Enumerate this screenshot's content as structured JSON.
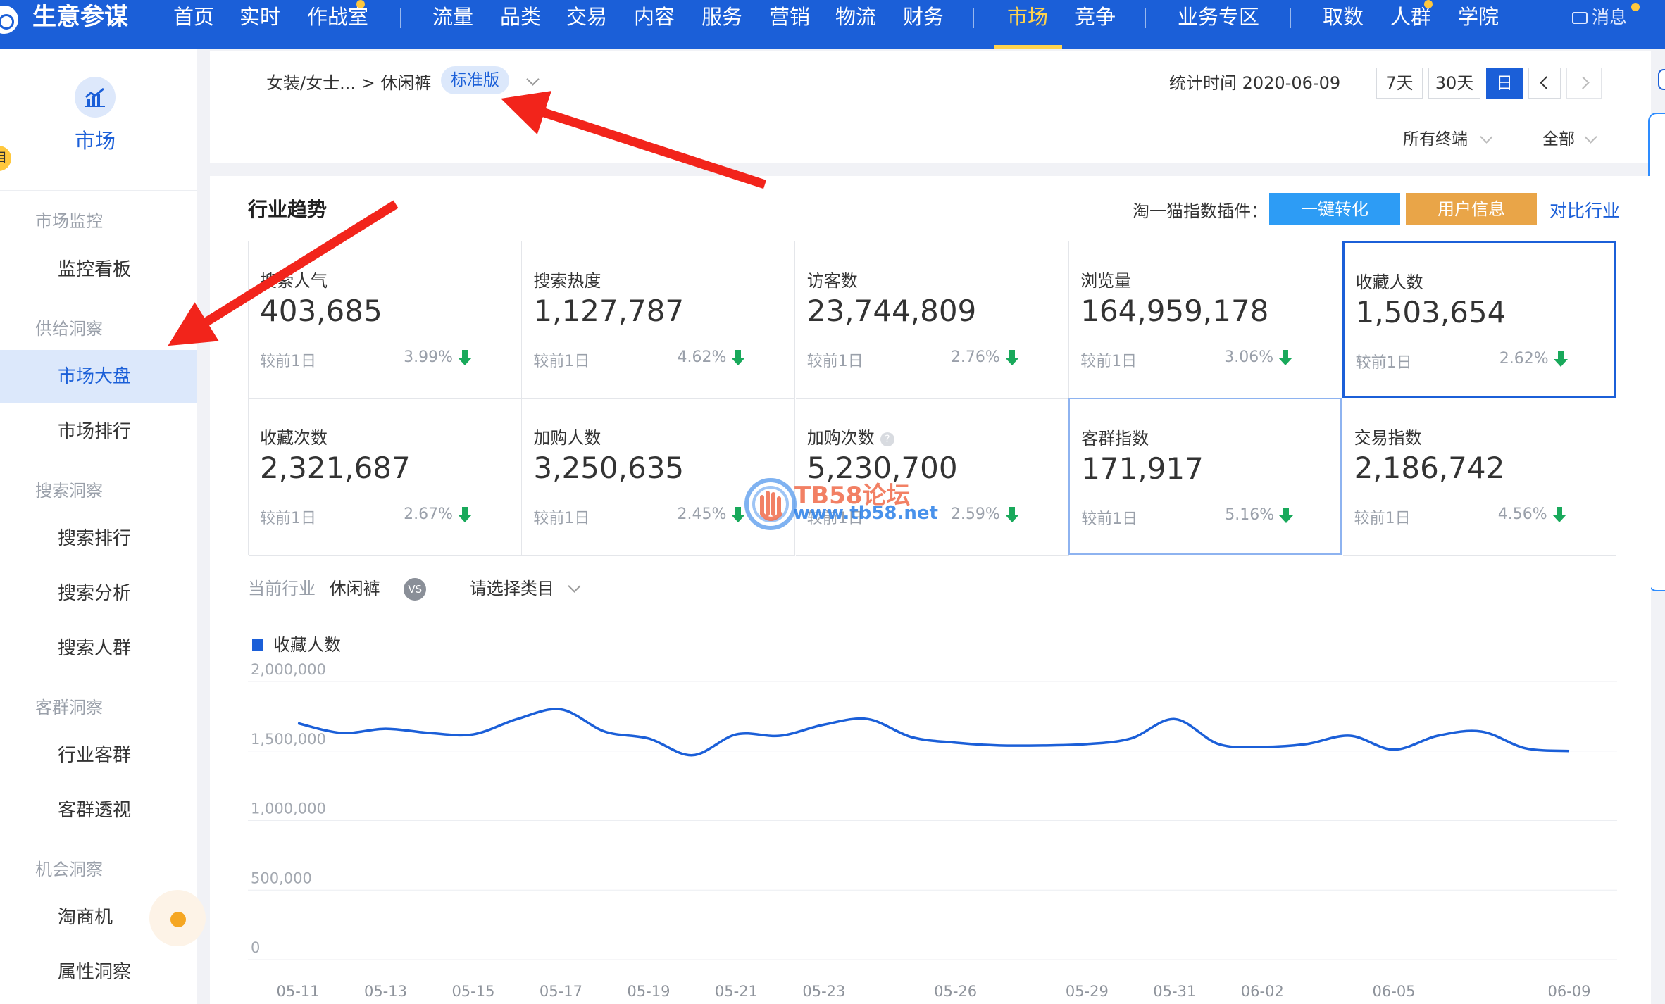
{
  "topnav": {
    "brand": "生意参谋",
    "items": [
      "首页",
      "实时",
      "作战室",
      "流量",
      "品类",
      "交易",
      "内容",
      "服务",
      "营销",
      "物流",
      "财务",
      "市场",
      "竞争",
      "业务专区",
      "取数",
      "人群",
      "学院"
    ],
    "active": "市场",
    "message": "消息"
  },
  "sidebar": {
    "badge": "目",
    "module_label": "市场",
    "groups": [
      {
        "title": "市场监控",
        "items": [
          "监控看板"
        ]
      },
      {
        "title": "供给洞察",
        "items": [
          "市场大盘",
          "市场排行"
        ]
      },
      {
        "title": "搜索洞察",
        "items": [
          "搜索排行",
          "搜索分析",
          "搜索人群"
        ]
      },
      {
        "title": "客群洞察",
        "items": [
          "行业客群",
          "客群透视"
        ]
      },
      {
        "title": "机会洞察",
        "items": [
          "淘商机",
          "属性洞察"
        ]
      }
    ],
    "active_item": "市场大盘"
  },
  "header": {
    "breadcrumb": "女装/女士... > 休闲裤",
    "version_tag": "标准版",
    "stat_time": "统计时间 2020-06-09",
    "range_buttons": [
      "7天",
      "30天",
      "日"
    ],
    "active_range": "日",
    "filters": [
      "所有终端",
      "全部"
    ]
  },
  "trend": {
    "title": "行业趋势",
    "plugin_label": "淘一猫指数插件：",
    "plugin_buttons": [
      "一键转化",
      "用户信息"
    ],
    "compare_link": "对比行业",
    "compare_prefix": "较前1日",
    "metrics": [
      {
        "label": "搜索人气",
        "value": "403,685",
        "change": "3.99%",
        "direction": "down"
      },
      {
        "label": "搜索热度",
        "value": "1,127,787",
        "change": "4.62%",
        "direction": "down"
      },
      {
        "label": "访客数",
        "value": "23,744,809",
        "change": "2.76%",
        "direction": "down"
      },
      {
        "label": "浏览量",
        "value": "164,959,178",
        "change": "3.06%",
        "direction": "down"
      },
      {
        "label": "收藏人数",
        "value": "1,503,654",
        "change": "2.62%",
        "direction": "down",
        "selected": true
      },
      {
        "label": "收藏次数",
        "value": "2,321,687",
        "change": "2.67%",
        "direction": "down"
      },
      {
        "label": "加购人数",
        "value": "3,250,635",
        "change": "2.45%",
        "direction": "down"
      },
      {
        "label": "加购次数",
        "value": "5,230,700",
        "change": "2.59%",
        "direction": "down",
        "help": true
      },
      {
        "label": "客群指数",
        "value": "171,917",
        "change": "5.16%",
        "direction": "down",
        "highlight": true
      },
      {
        "label": "交易指数",
        "value": "2,186,742",
        "change": "4.56%",
        "direction": "down"
      }
    ],
    "industry_label": "当前行业",
    "industry_value": "休闲裤",
    "vs": "VS",
    "category_placeholder": "请选择类目"
  },
  "watermark": {
    "line1": "TB58论坛",
    "line2": "www.tb58.net"
  },
  "chart_data": {
    "type": "line",
    "series": [
      {
        "name": "收藏人数",
        "color": "#1b5fd8",
        "x": [
          "05-11",
          "05-12",
          "05-13",
          "05-14",
          "05-15",
          "05-16",
          "05-17",
          "05-18",
          "05-19",
          "05-20",
          "05-21",
          "05-22",
          "05-23",
          "05-24",
          "05-25",
          "05-26",
          "05-27",
          "05-28",
          "05-29",
          "05-30",
          "05-31",
          "06-01",
          "06-02",
          "06-03",
          "06-04",
          "06-05",
          "06-06",
          "06-07",
          "06-08",
          "06-09"
        ],
        "values": [
          1700000,
          1630000,
          1660000,
          1630000,
          1620000,
          1730000,
          1800000,
          1640000,
          1590000,
          1470000,
          1620000,
          1610000,
          1690000,
          1730000,
          1600000,
          1560000,
          1540000,
          1540000,
          1550000,
          1590000,
          1730000,
          1550000,
          1530000,
          1550000,
          1610000,
          1510000,
          1610000,
          1640000,
          1520000,
          1500000
        ]
      }
    ],
    "x_ticks": [
      "05-11",
      "05-13",
      "05-15",
      "05-17",
      "05-19",
      "05-21",
      "05-23",
      "05-26",
      "05-29",
      "05-31",
      "06-02",
      "06-05",
      "06-09"
    ],
    "y_ticks": [
      "0",
      "500,000",
      "1,000,000",
      "1,500,000",
      "2,000,000"
    ],
    "ylim": [
      0,
      2000000
    ],
    "grid": true,
    "legend": "top-left"
  }
}
